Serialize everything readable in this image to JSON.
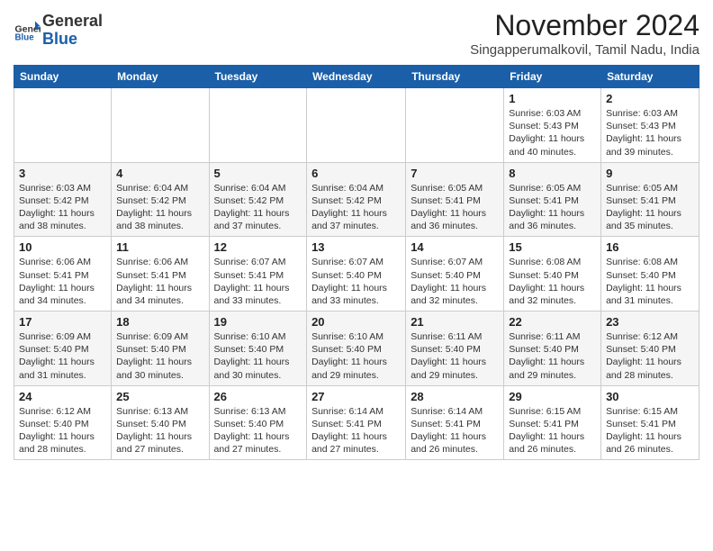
{
  "header": {
    "logo_line1": "General",
    "logo_line2": "Blue",
    "month": "November 2024",
    "location": "Singapperumalkovil, Tamil Nadu, India"
  },
  "days_of_week": [
    "Sunday",
    "Monday",
    "Tuesday",
    "Wednesday",
    "Thursday",
    "Friday",
    "Saturday"
  ],
  "weeks": [
    [
      {
        "day": "",
        "info": ""
      },
      {
        "day": "",
        "info": ""
      },
      {
        "day": "",
        "info": ""
      },
      {
        "day": "",
        "info": ""
      },
      {
        "day": "",
        "info": ""
      },
      {
        "day": "1",
        "info": "Sunrise: 6:03 AM\nSunset: 5:43 PM\nDaylight: 11 hours and 40 minutes."
      },
      {
        "day": "2",
        "info": "Sunrise: 6:03 AM\nSunset: 5:43 PM\nDaylight: 11 hours and 39 minutes."
      }
    ],
    [
      {
        "day": "3",
        "info": "Sunrise: 6:03 AM\nSunset: 5:42 PM\nDaylight: 11 hours and 38 minutes."
      },
      {
        "day": "4",
        "info": "Sunrise: 6:04 AM\nSunset: 5:42 PM\nDaylight: 11 hours and 38 minutes."
      },
      {
        "day": "5",
        "info": "Sunrise: 6:04 AM\nSunset: 5:42 PM\nDaylight: 11 hours and 37 minutes."
      },
      {
        "day": "6",
        "info": "Sunrise: 6:04 AM\nSunset: 5:42 PM\nDaylight: 11 hours and 37 minutes."
      },
      {
        "day": "7",
        "info": "Sunrise: 6:05 AM\nSunset: 5:41 PM\nDaylight: 11 hours and 36 minutes."
      },
      {
        "day": "8",
        "info": "Sunrise: 6:05 AM\nSunset: 5:41 PM\nDaylight: 11 hours and 36 minutes."
      },
      {
        "day": "9",
        "info": "Sunrise: 6:05 AM\nSunset: 5:41 PM\nDaylight: 11 hours and 35 minutes."
      }
    ],
    [
      {
        "day": "10",
        "info": "Sunrise: 6:06 AM\nSunset: 5:41 PM\nDaylight: 11 hours and 34 minutes."
      },
      {
        "day": "11",
        "info": "Sunrise: 6:06 AM\nSunset: 5:41 PM\nDaylight: 11 hours and 34 minutes."
      },
      {
        "day": "12",
        "info": "Sunrise: 6:07 AM\nSunset: 5:41 PM\nDaylight: 11 hours and 33 minutes."
      },
      {
        "day": "13",
        "info": "Sunrise: 6:07 AM\nSunset: 5:40 PM\nDaylight: 11 hours and 33 minutes."
      },
      {
        "day": "14",
        "info": "Sunrise: 6:07 AM\nSunset: 5:40 PM\nDaylight: 11 hours and 32 minutes."
      },
      {
        "day": "15",
        "info": "Sunrise: 6:08 AM\nSunset: 5:40 PM\nDaylight: 11 hours and 32 minutes."
      },
      {
        "day": "16",
        "info": "Sunrise: 6:08 AM\nSunset: 5:40 PM\nDaylight: 11 hours and 31 minutes."
      }
    ],
    [
      {
        "day": "17",
        "info": "Sunrise: 6:09 AM\nSunset: 5:40 PM\nDaylight: 11 hours and 31 minutes."
      },
      {
        "day": "18",
        "info": "Sunrise: 6:09 AM\nSunset: 5:40 PM\nDaylight: 11 hours and 30 minutes."
      },
      {
        "day": "19",
        "info": "Sunrise: 6:10 AM\nSunset: 5:40 PM\nDaylight: 11 hours and 30 minutes."
      },
      {
        "day": "20",
        "info": "Sunrise: 6:10 AM\nSunset: 5:40 PM\nDaylight: 11 hours and 29 minutes."
      },
      {
        "day": "21",
        "info": "Sunrise: 6:11 AM\nSunset: 5:40 PM\nDaylight: 11 hours and 29 minutes."
      },
      {
        "day": "22",
        "info": "Sunrise: 6:11 AM\nSunset: 5:40 PM\nDaylight: 11 hours and 29 minutes."
      },
      {
        "day": "23",
        "info": "Sunrise: 6:12 AM\nSunset: 5:40 PM\nDaylight: 11 hours and 28 minutes."
      }
    ],
    [
      {
        "day": "24",
        "info": "Sunrise: 6:12 AM\nSunset: 5:40 PM\nDaylight: 11 hours and 28 minutes."
      },
      {
        "day": "25",
        "info": "Sunrise: 6:13 AM\nSunset: 5:40 PM\nDaylight: 11 hours and 27 minutes."
      },
      {
        "day": "26",
        "info": "Sunrise: 6:13 AM\nSunset: 5:40 PM\nDaylight: 11 hours and 27 minutes."
      },
      {
        "day": "27",
        "info": "Sunrise: 6:14 AM\nSunset: 5:41 PM\nDaylight: 11 hours and 27 minutes."
      },
      {
        "day": "28",
        "info": "Sunrise: 6:14 AM\nSunset: 5:41 PM\nDaylight: 11 hours and 26 minutes."
      },
      {
        "day": "29",
        "info": "Sunrise: 6:15 AM\nSunset: 5:41 PM\nDaylight: 11 hours and 26 minutes."
      },
      {
        "day": "30",
        "info": "Sunrise: 6:15 AM\nSunset: 5:41 PM\nDaylight: 11 hours and 26 minutes."
      }
    ]
  ]
}
